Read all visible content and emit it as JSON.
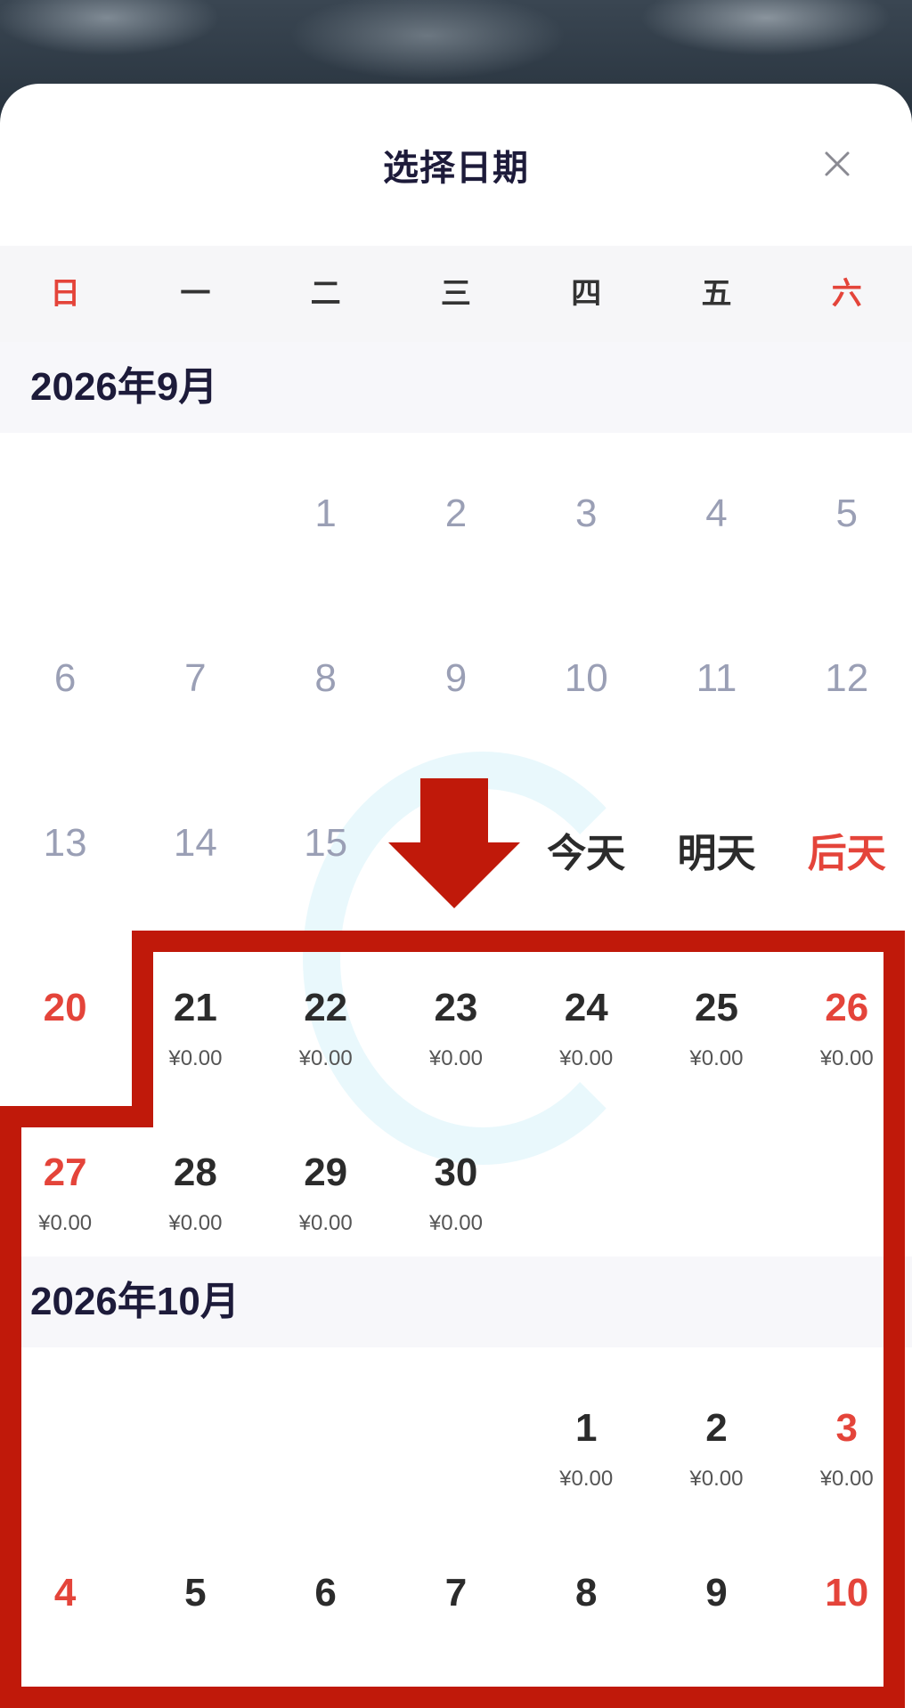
{
  "header": {
    "title": "选择日期",
    "close_icon": "close-icon"
  },
  "weekdays": [
    "日",
    "一",
    "二",
    "三",
    "四",
    "五",
    "六"
  ],
  "weekend_color": "#e4443a",
  "highlight_color": "#c0190a",
  "months": [
    {
      "title": "2026年9月",
      "cells": [
        {
          "text": ""
        },
        {
          "text": ""
        },
        {
          "text": "1",
          "state": "past"
        },
        {
          "text": "2",
          "state": "past"
        },
        {
          "text": "3",
          "state": "past"
        },
        {
          "text": "4",
          "state": "past"
        },
        {
          "text": "5",
          "state": "past"
        },
        {
          "text": "6",
          "state": "past"
        },
        {
          "text": "7",
          "state": "past"
        },
        {
          "text": "8",
          "state": "past"
        },
        {
          "text": "9",
          "state": "past"
        },
        {
          "text": "10",
          "state": "past"
        },
        {
          "text": "11",
          "state": "past"
        },
        {
          "text": "12",
          "state": "past"
        },
        {
          "text": "13",
          "state": "past"
        },
        {
          "text": "14",
          "state": "past"
        },
        {
          "text": "15",
          "state": "past"
        },
        {
          "text": "",
          "state": "hidden"
        },
        {
          "text": "今天",
          "state": "label"
        },
        {
          "text": "明天",
          "state": "label"
        },
        {
          "text": "后天",
          "state": "red"
        },
        {
          "text": "20",
          "state": "red"
        },
        {
          "text": "21",
          "price": "¥0.00"
        },
        {
          "text": "22",
          "price": "¥0.00"
        },
        {
          "text": "23",
          "price": "¥0.00"
        },
        {
          "text": "24",
          "price": "¥0.00"
        },
        {
          "text": "25",
          "price": "¥0.00"
        },
        {
          "text": "26",
          "state": "red",
          "price": "¥0.00"
        },
        {
          "text": "27",
          "state": "red",
          "price": "¥0.00"
        },
        {
          "text": "28",
          "price": "¥0.00"
        },
        {
          "text": "29",
          "price": "¥0.00"
        },
        {
          "text": "30",
          "price": "¥0.00"
        }
      ]
    },
    {
      "title": "2026年10月",
      "cells": [
        {
          "text": ""
        },
        {
          "text": ""
        },
        {
          "text": ""
        },
        {
          "text": ""
        },
        {
          "text": "1",
          "price": "¥0.00"
        },
        {
          "text": "2",
          "price": "¥0.00"
        },
        {
          "text": "3",
          "state": "red",
          "price": "¥0.00"
        },
        {
          "text": "4",
          "state": "red"
        },
        {
          "text": "5"
        },
        {
          "text": "6"
        },
        {
          "text": "7"
        },
        {
          "text": "8"
        },
        {
          "text": "9"
        },
        {
          "text": "10",
          "state": "red"
        }
      ]
    }
  ]
}
